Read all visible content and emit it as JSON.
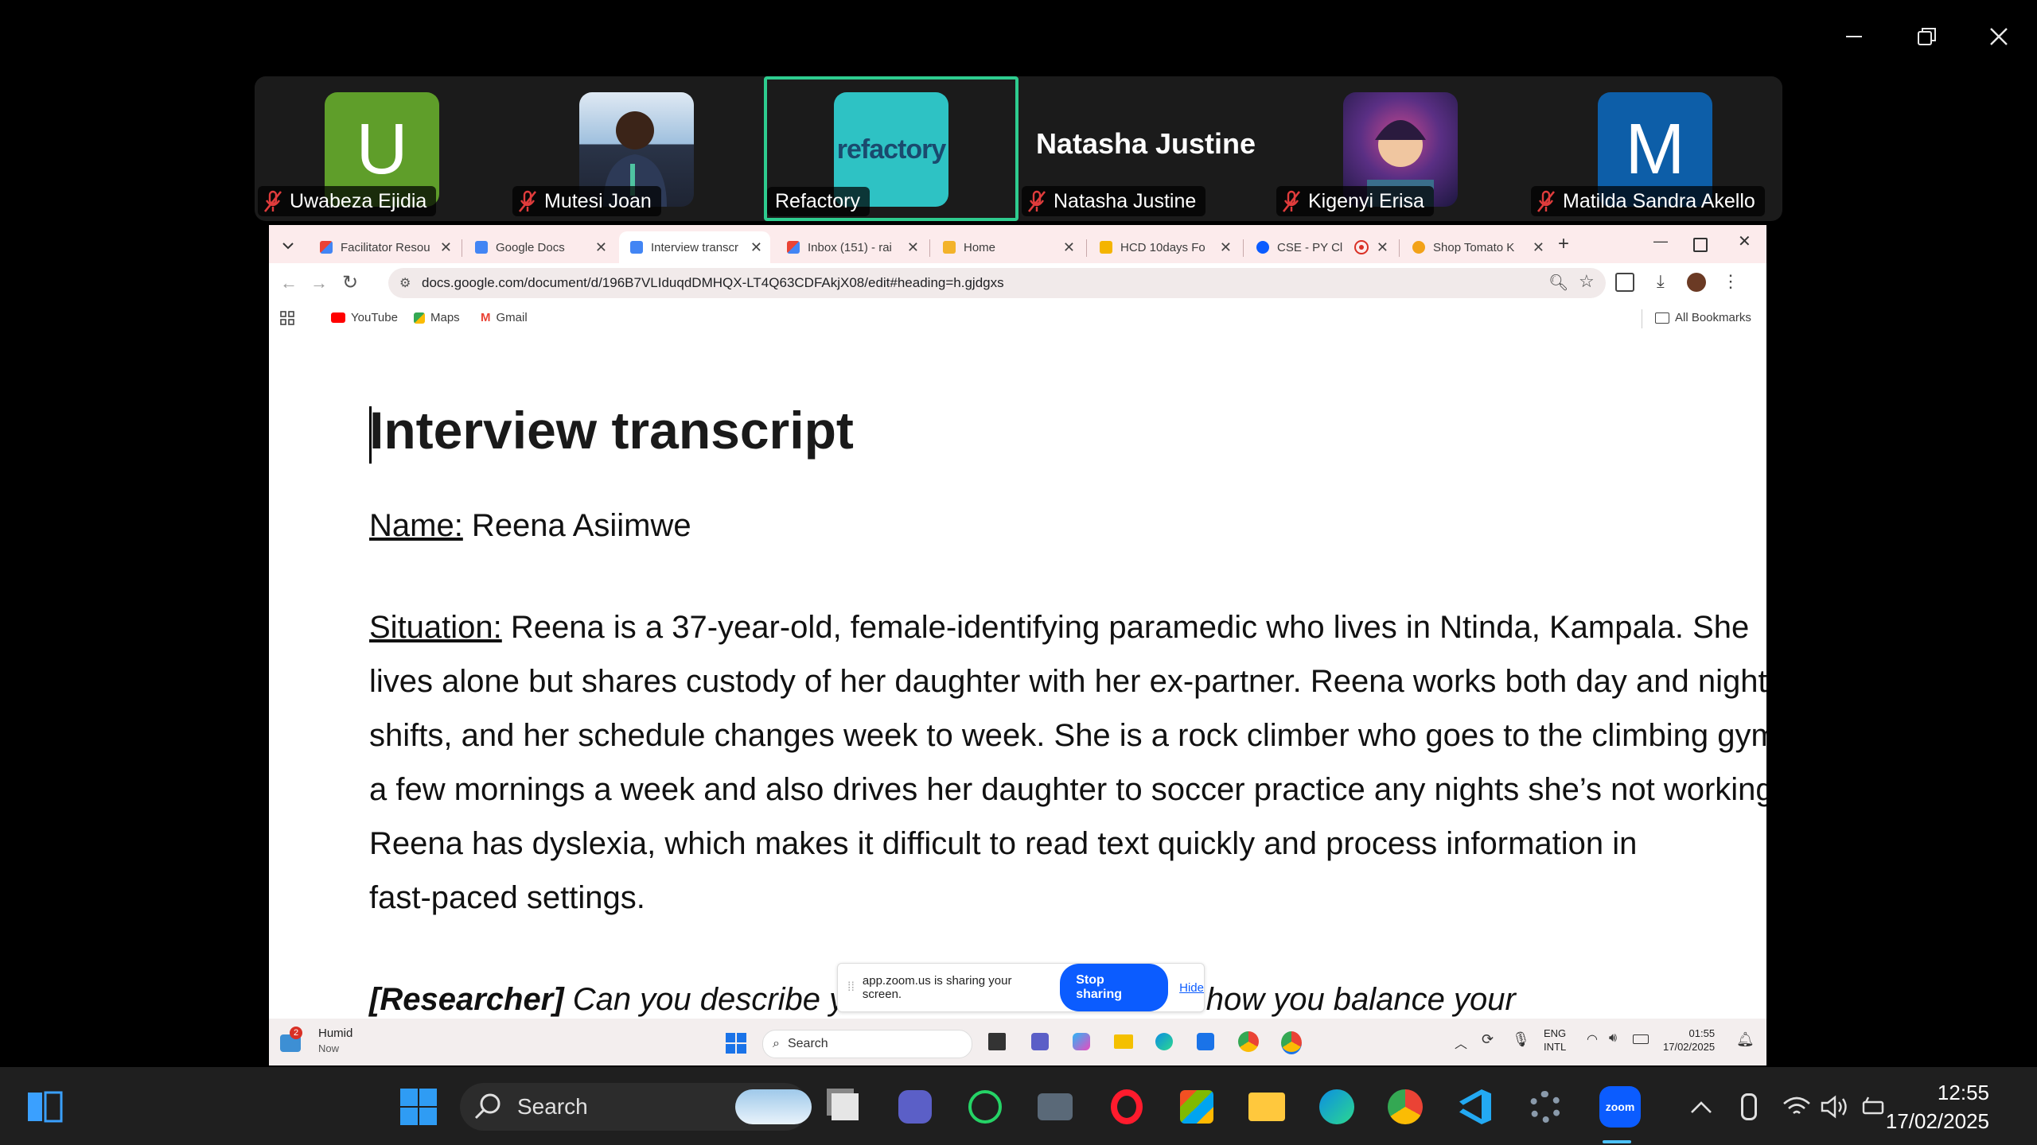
{
  "window_controls": {
    "minimize": "minimize-icon",
    "restore": "restore-icon",
    "close": "close-icon"
  },
  "participants": [
    {
      "name": "Uwabeza Ejidia",
      "avatar_letter": "U",
      "avatar_color": "#5f9e2a",
      "muted": true
    },
    {
      "name": "Mutesi Joan",
      "avatar_letter": "",
      "avatar_color": "#8fb6d8",
      "muted": true
    },
    {
      "name": "Refactory",
      "avatar_letter": "",
      "avatar_color": "#2ec2c4",
      "muted": false,
      "logo_text": "refactory"
    },
    {
      "name": "Natasha Justine",
      "avatar_letter": "",
      "avatar_color": "#1b1b1b",
      "muted": true,
      "display_name": "Natasha Justine"
    },
    {
      "name": "Kigenyi Erisa",
      "avatar_letter": "",
      "avatar_color": "#4a2c6e",
      "muted": true
    },
    {
      "name": "Matilda Sandra Akello",
      "avatar_letter": "M",
      "avatar_color": "#0d5ea8",
      "muted": true
    }
  ],
  "browser": {
    "tabs": [
      {
        "title": "Facilitator Resou",
        "icon": "gmail-icon",
        "color": "#ea4335"
      },
      {
        "title": "Google Docs",
        "icon": "docs-icon",
        "color": "#4285f4"
      },
      {
        "title": "Interview transcr",
        "icon": "docs-icon",
        "color": "#4285f4",
        "active": true
      },
      {
        "title": "Inbox (151) - rai",
        "icon": "gmail-icon",
        "color": "#ea4335"
      },
      {
        "title": "Home",
        "icon": "classroom-icon",
        "color": "#f3b32a"
      },
      {
        "title": "HCD 10days Fo",
        "icon": "slides-icon",
        "color": "#f4b400"
      },
      {
        "title": "CSE - PY Cl",
        "icon": "zoom-icon",
        "color": "#0b5cff"
      },
      {
        "title": "Shop Tomato K",
        "icon": "shop-icon",
        "color": "#f2a219"
      }
    ],
    "url": "docs.google.com/document/d/196B7VLIduqdDMHQX-LT4Q63CDFAkjX08/edit#heading=h.gjdgxs",
    "bookmarks": [
      "YouTube",
      "Maps",
      "Gmail"
    ],
    "all_bookmarks": "All Bookmarks"
  },
  "document": {
    "title": "Interview transcript",
    "name_label": "Name:",
    "name_value": " Reena Asiimwe",
    "situation_label": "Situation:",
    "situation_lines": [
      " Reena is a 37-year-old, female-identifying paramedic who lives in Ntinda, Kampala. She",
      "lives alone but shares custody of her daughter with her ex-partner. Reena works both day and night",
      "shifts, and her schedule changes week to week. She is a rock climber who goes to the climbing gym",
      "a few mornings a week and also drives her daughter to soccer practice any nights she’s not working.",
      "Reena has dyslexia, which makes it difficult to read text quickly and process information in",
      "fast-paced settings."
    ],
    "question_label": "[Researcher]",
    "question_text": " Can you describe your current schedule and how you balance your"
  },
  "share_bar": {
    "message": "app.zoom.us is sharing your screen.",
    "stop": "Stop sharing",
    "hide": "Hide"
  },
  "inner_taskbar": {
    "weather": "Humid",
    "weather_time": "Now",
    "weather_badge": "2",
    "search": "Search",
    "lang1": "ENG",
    "lang2": "INTL",
    "time": "01:55",
    "date": "17/02/2025"
  },
  "taskbar": {
    "search": "Search",
    "time": "12:55",
    "date": "17/02/2025"
  }
}
